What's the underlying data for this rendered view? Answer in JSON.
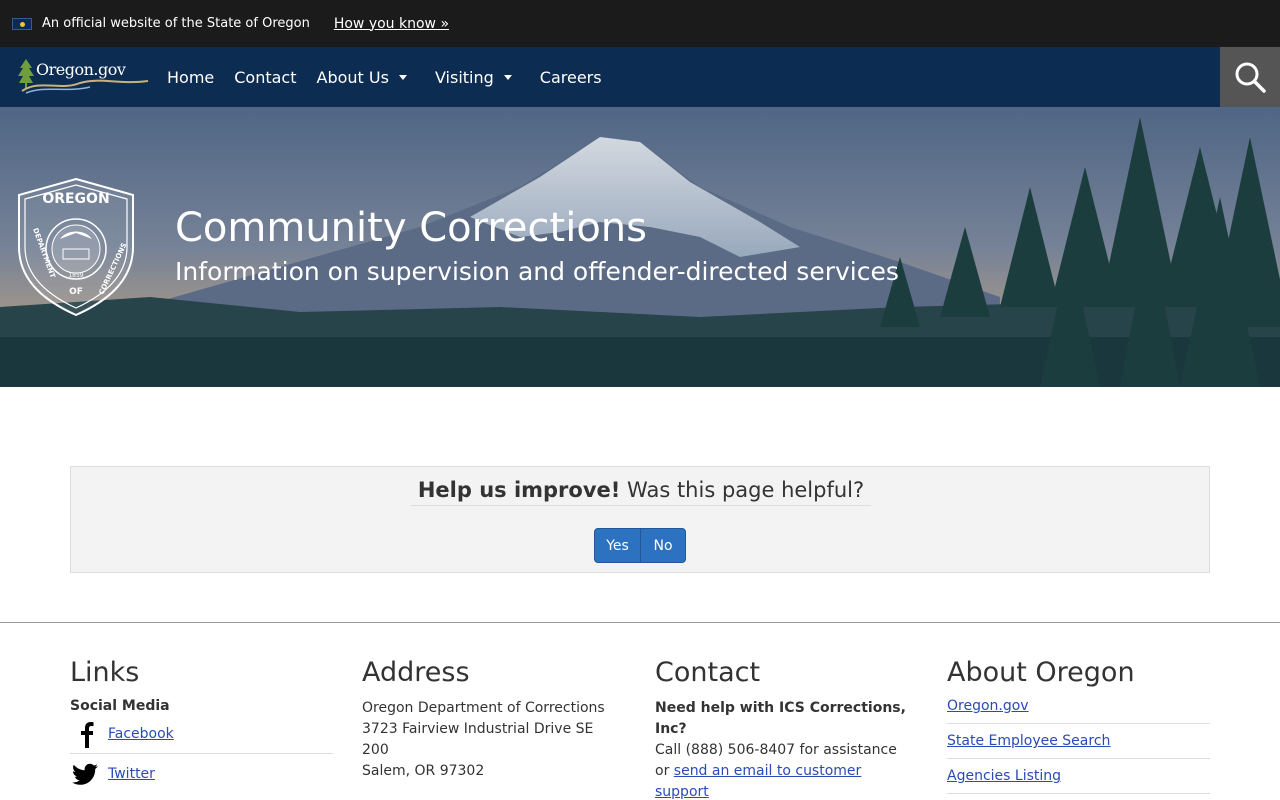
{
  "banner": {
    "official_text": "An official website of the State of Oregon",
    "how_you_know": "How you know »"
  },
  "logo": {
    "text": "Oregon.gov"
  },
  "nav": {
    "items": [
      {
        "label": "Home",
        "dropdown": false
      },
      {
        "label": "Contact",
        "dropdown": false
      },
      {
        "label": "About Us",
        "dropdown": true
      },
      {
        "label": "Visiting",
        "dropdown": true
      },
      {
        "label": "Careers",
        "dropdown": false
      }
    ],
    "search_icon": "search-icon"
  },
  "hero": {
    "title": "Community Corrections",
    "subtitle": "Information on supervision and offender-directed services",
    "seal_top": "OREGON",
    "seal_left": "DEPARTMENT",
    "seal_right": "CORRECTIONS",
    "seal_bottom": "OF",
    "seal_year": "1859"
  },
  "feedback": {
    "bold": "Help us improve!",
    "question": "Was this page helpful?",
    "yes": "Yes",
    "no": "No"
  },
  "footer": {
    "links": {
      "heading": "Links",
      "social_label": "Social Media",
      "facebook": "Facebook",
      "twitter": "Twitter"
    },
    "address": {
      "heading": "Address",
      "line1": "Oregon Department of Corrections",
      "line2": "3723 Fairview Industrial Drive SE",
      "line3": "200",
      "line4": "Salem, OR 97302"
    },
    "contact": {
      "heading": "Contact",
      "bold": "Need help with ICS Corrections, Inc?",
      "text": "Call (888) 506-8407 for assistance or",
      "link": "send an email to customer support"
    },
    "about": {
      "heading": "About Oregon",
      "items": [
        "Oregon.gov",
        "State Employee Search",
        "Agencies Listing"
      ]
    }
  },
  "colors": {
    "banner_bg": "#1b1b1b",
    "nav_bg": "#0d2c51",
    "search_bg": "#555555",
    "button_blue": "#2d72c0",
    "link_blue": "#2a4ab7"
  }
}
